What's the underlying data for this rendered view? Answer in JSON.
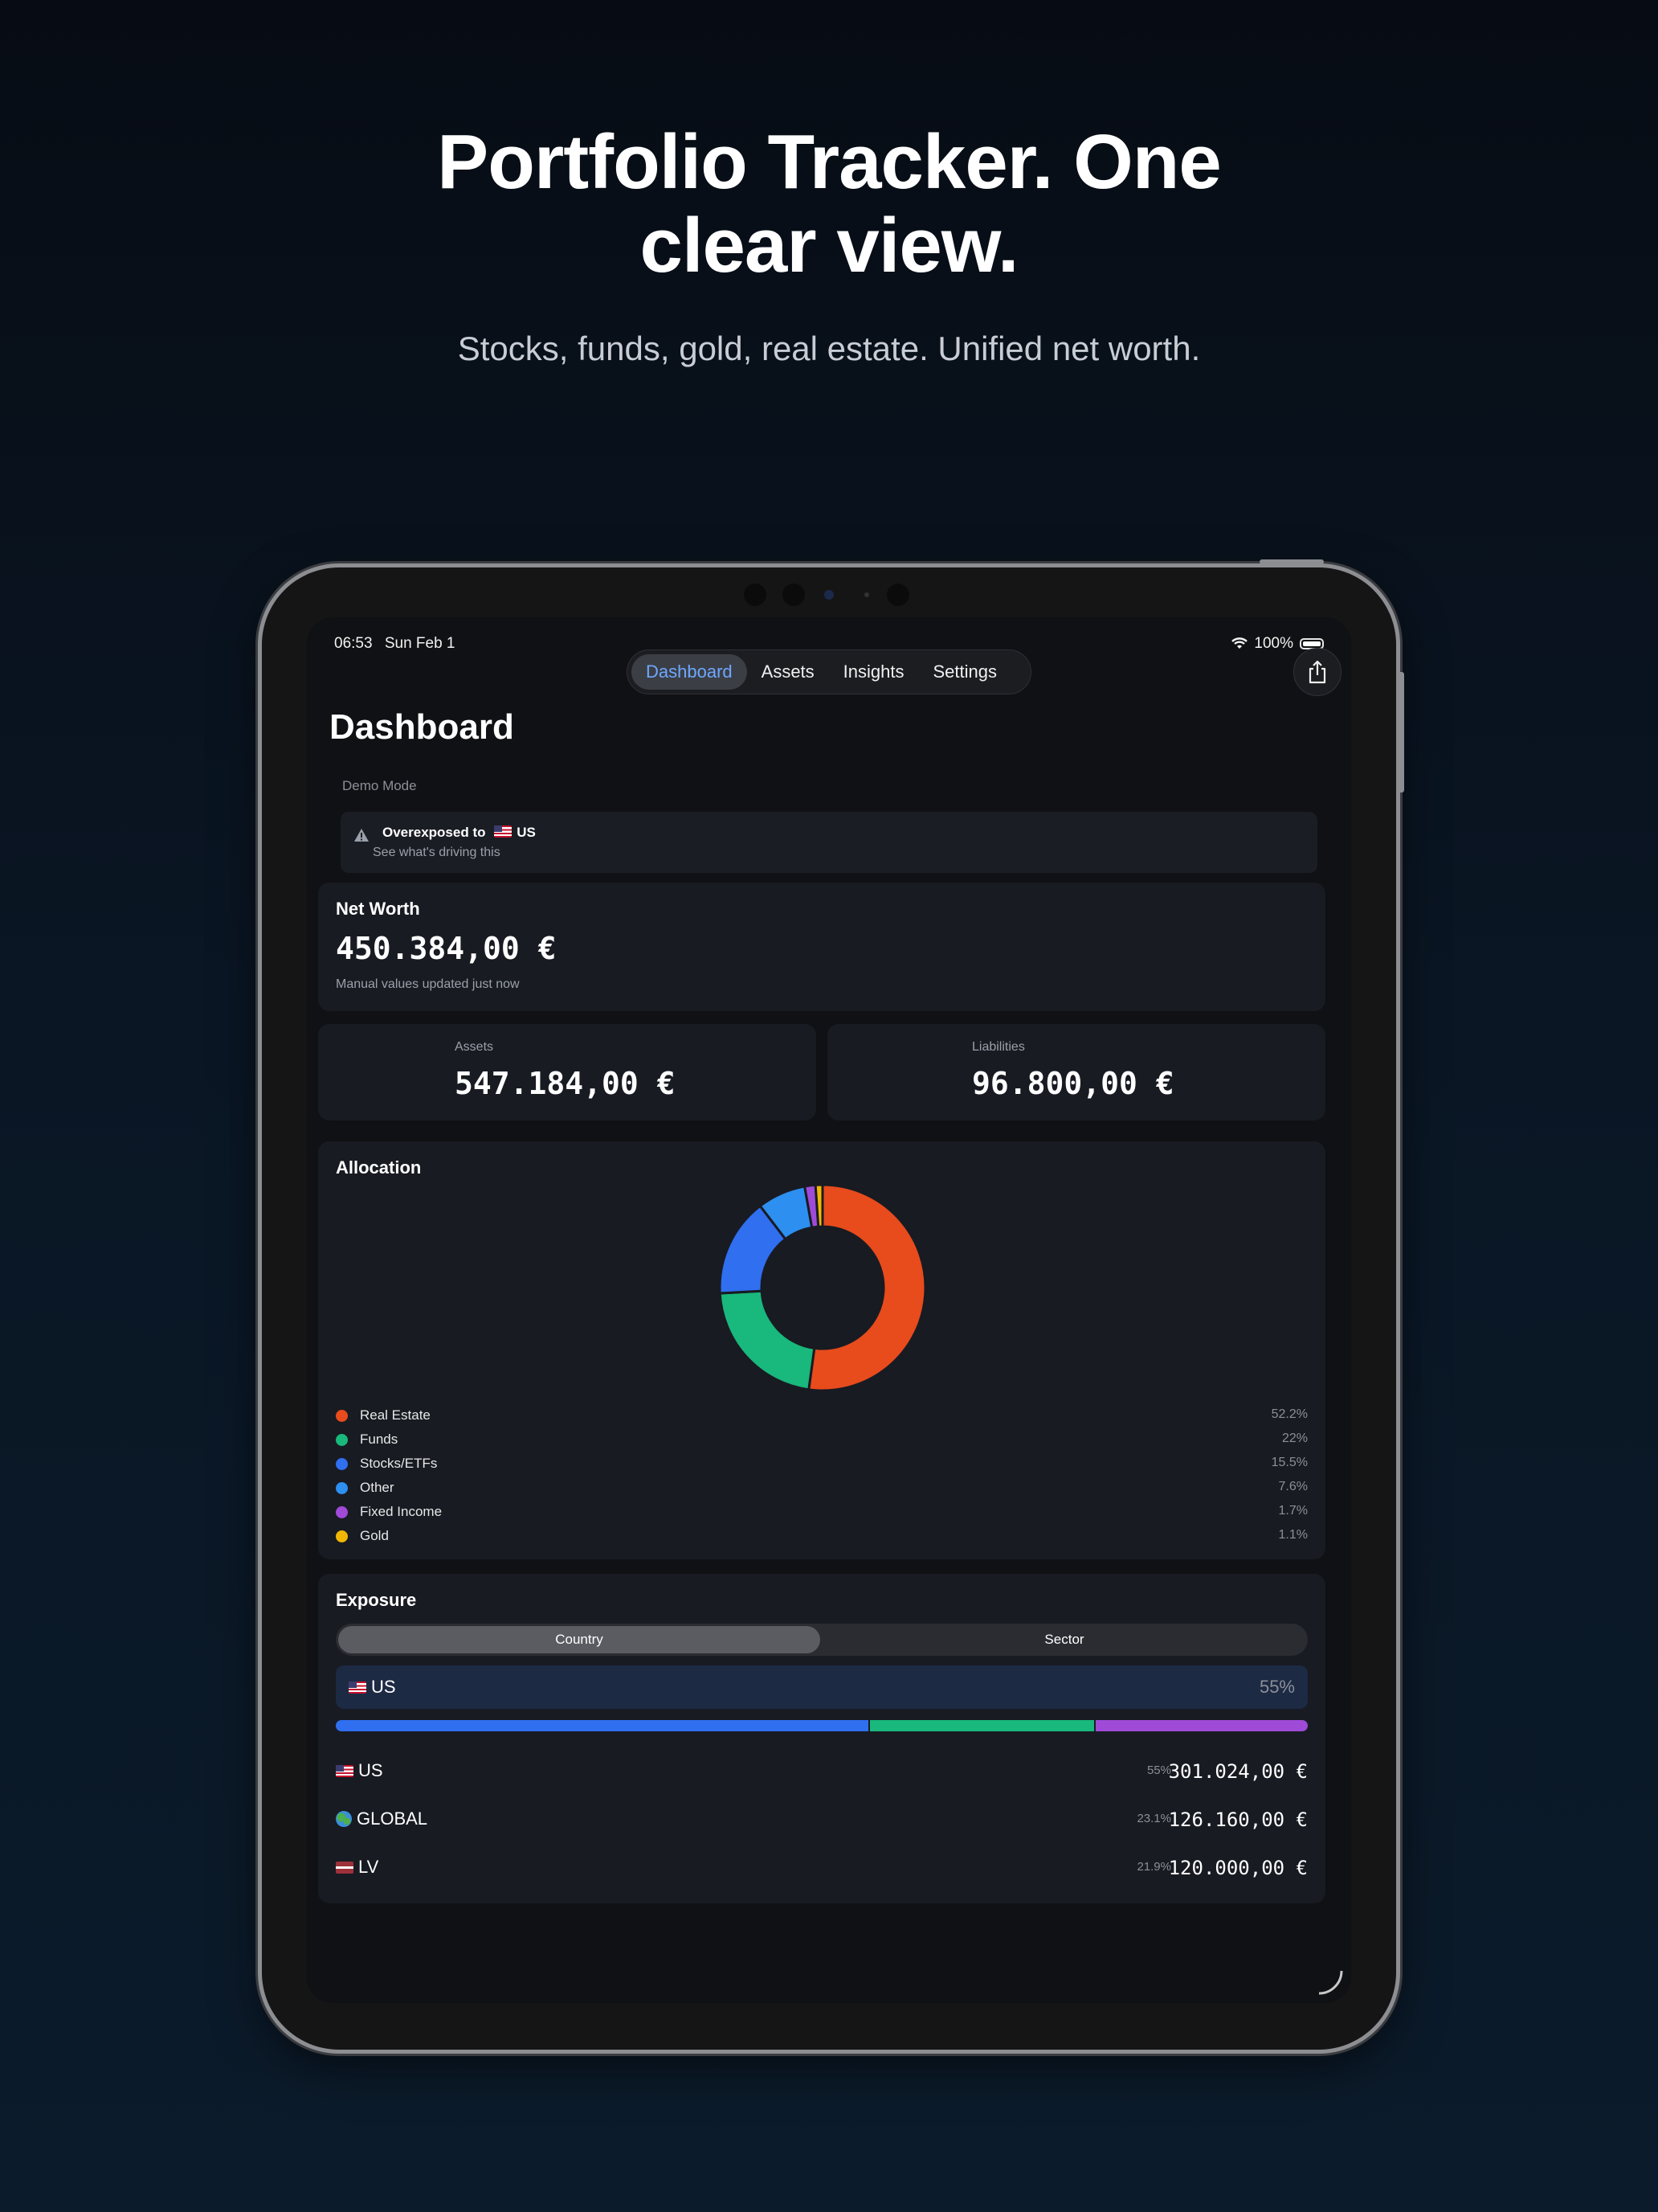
{
  "promo": {
    "headline_line1": "Portfolio Tracker. One",
    "headline_line2": "clear view.",
    "subheadline": "Stocks, funds, gold, real estate. Unified net worth."
  },
  "status_bar": {
    "time": "06:53",
    "date": "Sun Feb 1",
    "battery": "100%"
  },
  "nav": {
    "tabs": [
      "Dashboard",
      "Assets",
      "Insights",
      "Settings"
    ],
    "active": "Dashboard"
  },
  "page_title": "Dashboard",
  "demo_mode_label": "Demo Mode",
  "alert": {
    "title": "Overexposed to",
    "country": "US",
    "subtitle": "See what's driving this"
  },
  "net_worth": {
    "title": "Net Worth",
    "value": "450.384,00 €",
    "note": "Manual values updated just now"
  },
  "assets": {
    "label": "Assets",
    "value": "547.184,00 €"
  },
  "liabilities": {
    "label": "Liabilities",
    "value": "96.800,00 €"
  },
  "allocation": {
    "title": "Allocation"
  },
  "chart_data": {
    "type": "pie",
    "donut": true,
    "categories": [
      "Real Estate",
      "Funds",
      "Stocks/ETFs",
      "Other",
      "Fixed Income",
      "Gold"
    ],
    "values": [
      52.2,
      22,
      15.5,
      7.6,
      1.7,
      1.1
    ],
    "labels": [
      "52.2%",
      "22%",
      "15.5%",
      "7.6%",
      "1.7%",
      "1.1%"
    ],
    "colors": [
      "#e84b1c",
      "#19b87c",
      "#2f6ff0",
      "#2d8ff0",
      "#a04ad8",
      "#f2b705"
    ]
  },
  "exposure": {
    "title": "Exposure",
    "toggle": [
      "Country",
      "Sector"
    ],
    "active_toggle": "Country",
    "selected": {
      "name": "US",
      "pct": "55%"
    },
    "bar_colors": [
      "#2f6ff0",
      "#19b87c",
      "#a04ad8"
    ],
    "bar_shares": [
      0.55,
      0.231,
      0.219
    ],
    "rows": [
      {
        "flag": "us",
        "name": "US",
        "pct": "55%",
        "amount": "301.024,00 €"
      },
      {
        "flag": "globe",
        "name": "GLOBAL",
        "pct": "23.1%",
        "amount": "126.160,00 €"
      },
      {
        "flag": "lv",
        "name": "LV",
        "pct": "21.9%",
        "amount": "120.000,00 €"
      }
    ]
  }
}
